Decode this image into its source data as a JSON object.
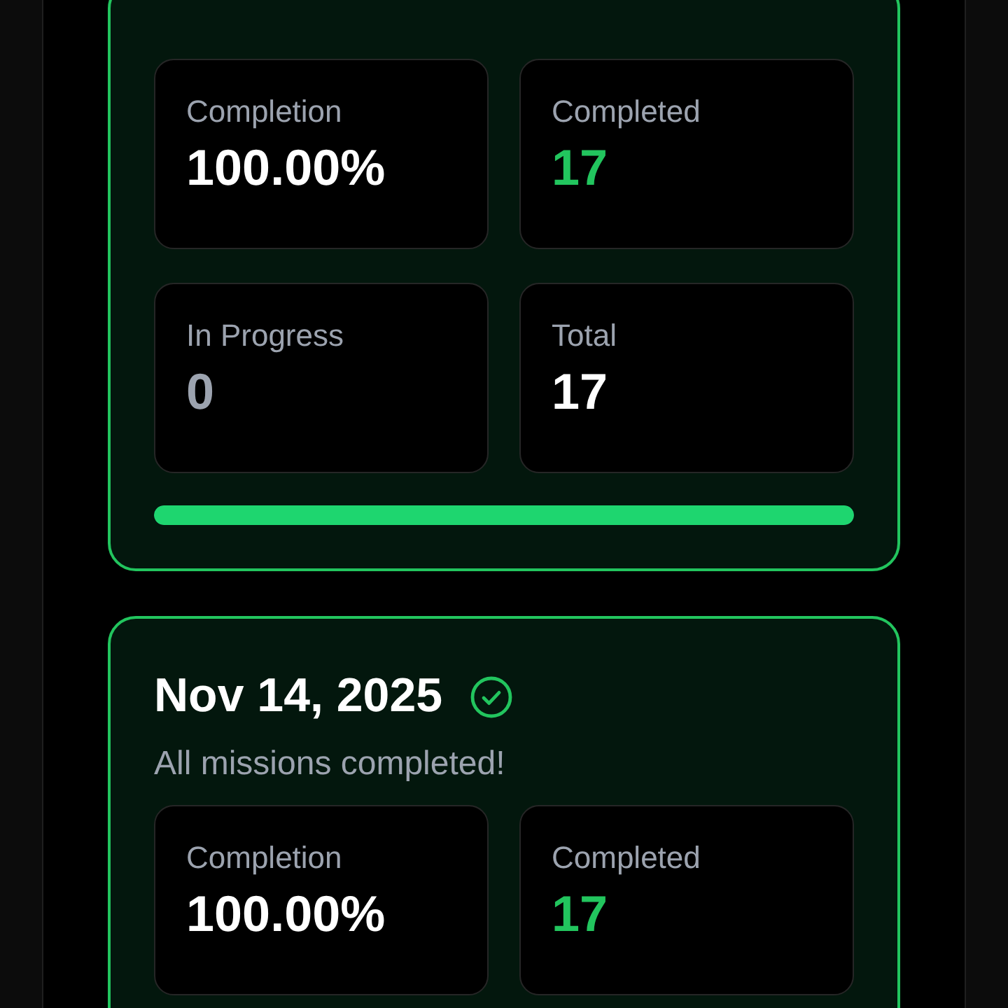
{
  "days": [
    {
      "complete": true,
      "stats": [
        {
          "label": "Completion",
          "value": "100.00%",
          "color": "#ffffff"
        },
        {
          "label": "Completed",
          "value": "17",
          "color": "#22c55e"
        },
        {
          "label": "In Progress",
          "value": "0",
          "color": "#9ca3af"
        },
        {
          "label": "Total",
          "value": "17",
          "color": "#ffffff"
        }
      ],
      "level": 1
    },
    {
      "title": "Nov 14, 2025",
      "complete": true,
      "subtitle": "All missions completed!",
      "stats": [
        {
          "label": "Completion",
          "value": "100.00%",
          "color": "#ffffff"
        },
        {
          "label": "Completed",
          "value": "17",
          "color": "#22c55e"
        }
      ]
    }
  ]
}
